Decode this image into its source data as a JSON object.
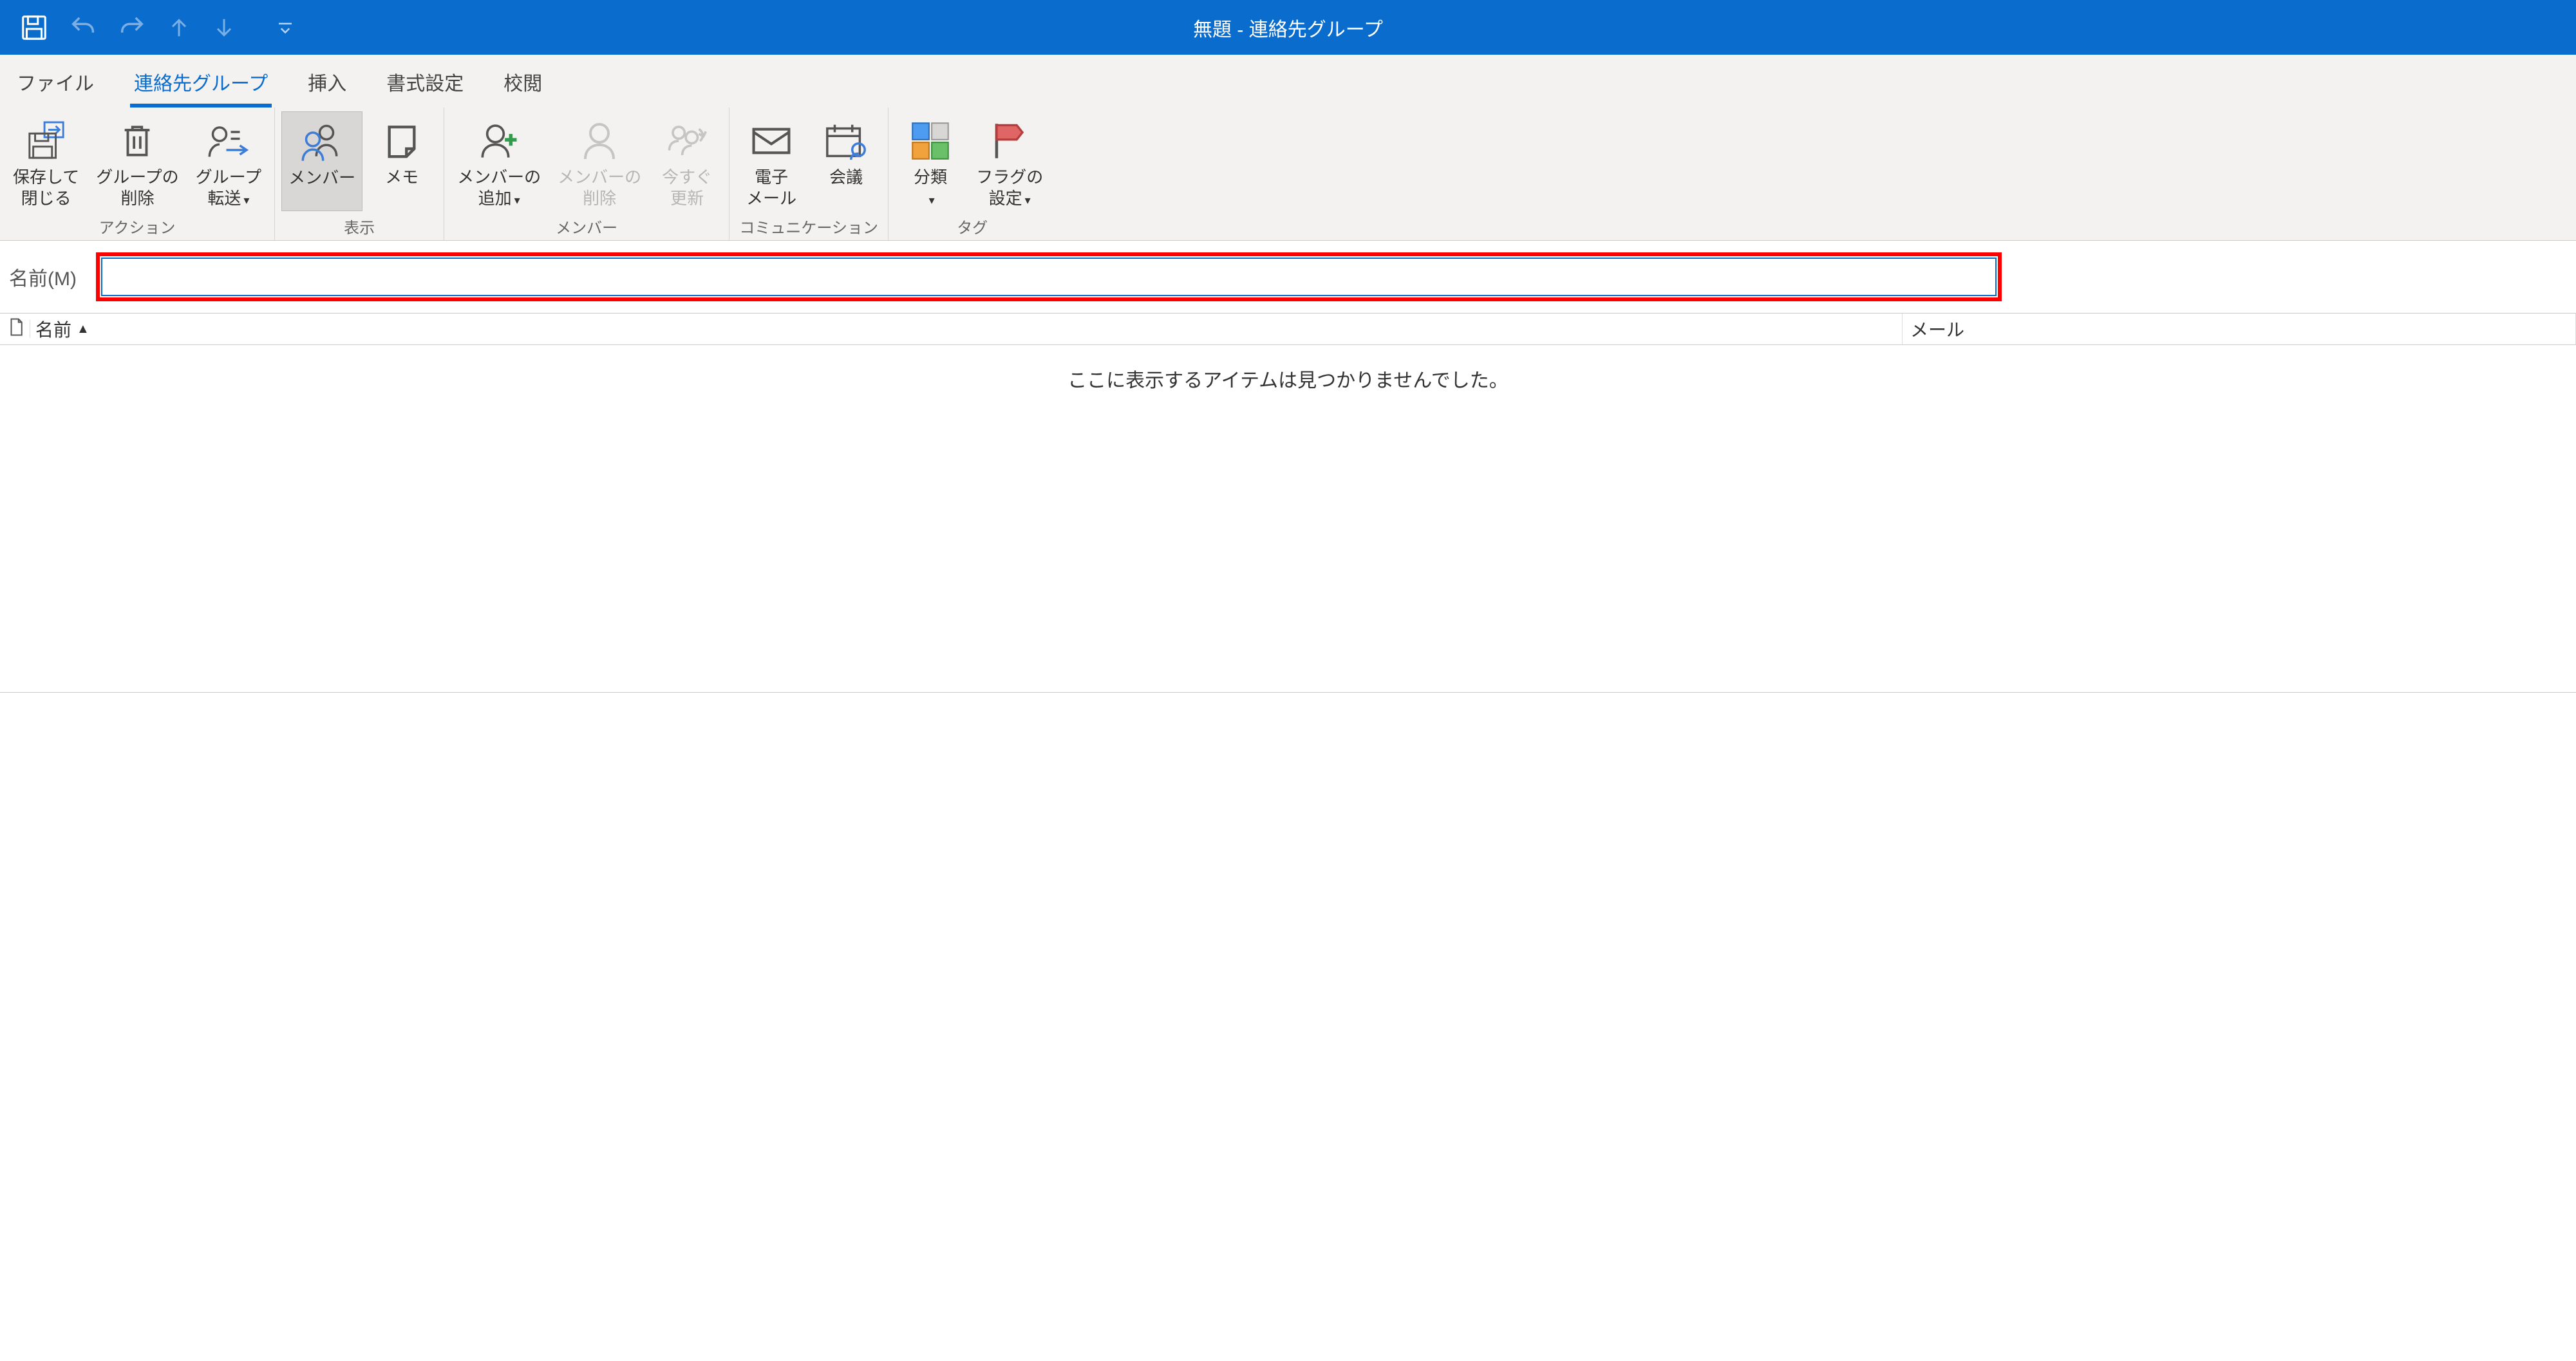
{
  "window": {
    "title": "無題 - 連絡先グループ"
  },
  "tabs": {
    "file": "ファイル",
    "contact_group": "連絡先グループ",
    "insert": "挿入",
    "format": "書式設定",
    "review": "校閲"
  },
  "ribbon": {
    "actions": {
      "label": "アクション",
      "save_close": "保存して\n閉じる",
      "delete_group": "グループの\n削除",
      "forward_group": "グループ\n転送"
    },
    "show": {
      "label": "表示",
      "members": "メンバー",
      "notes": "メモ"
    },
    "members": {
      "label": "メンバー",
      "add_member": "メンバーの\n追加",
      "remove_member": "メンバーの\n削除",
      "update_now": "今すぐ\n更新"
    },
    "communicate": {
      "label": "コミュニケーション",
      "email": "電子\nメール",
      "meeting": "会議"
    },
    "tags": {
      "label": "タグ",
      "categorize": "分類",
      "flag": "フラグの\n設定"
    }
  },
  "form": {
    "name_label": "名前(M)",
    "name_value": ""
  },
  "list": {
    "col_name": "名前",
    "col_mail": "メール",
    "empty": "ここに表示するアイテムは見つかりませんでした。"
  }
}
